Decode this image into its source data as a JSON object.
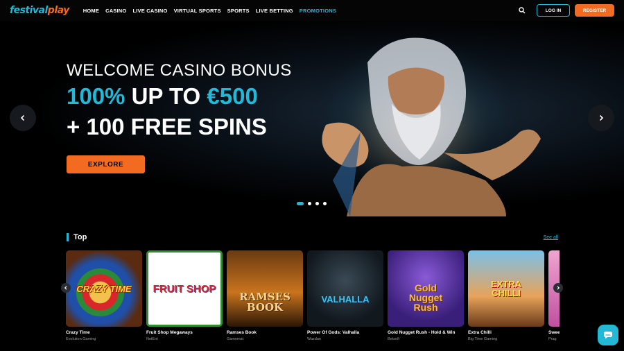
{
  "brand": {
    "logo_part1": "festival",
    "logo_part2": "play",
    "accent": "#22b8d6",
    "orange": "#f26b21"
  },
  "nav": [
    {
      "label": "HOME",
      "active": false
    },
    {
      "label": "CASINO",
      "active": false
    },
    {
      "label": "LIVE CASINO",
      "active": false
    },
    {
      "label": "VIRTUAL SPORTS",
      "active": false
    },
    {
      "label": "SPORTS",
      "active": false
    },
    {
      "label": "LIVE BETTING",
      "active": false
    },
    {
      "label": "PROMOTIONS",
      "active": true
    }
  ],
  "header": {
    "search_icon": "search-icon",
    "login_label": "LOG IN",
    "register_label": "REGISTER"
  },
  "hero": {
    "line1": "WELCOME CASINO BONUS",
    "line2_highlight1": "100%",
    "line2_middle": " UP TO ",
    "line2_highlight2": "€500",
    "line3": "+ 100 FREE SPINS",
    "cta_label": "EXPLORE",
    "slides_total": 4,
    "active_slide": 1
  },
  "top_section": {
    "title": "Top",
    "see_all": "See all",
    "games": [
      {
        "name": "Crazy Time",
        "provider": "Evolution Gaming",
        "art": "CRAZY TIME"
      },
      {
        "name": "Fruit Shop Megaways",
        "provider": "NetEnt",
        "art": "FRUIT SHOP"
      },
      {
        "name": "Ramses Book",
        "provider": "Gamomat",
        "art": "RAMSES BOOK"
      },
      {
        "name": "Power Of Gods: Valhalla",
        "provider": "Wazdan",
        "art": "VALHALLA"
      },
      {
        "name": "Gold Nugget Rush - Hold & Win",
        "provider": "Betsoft",
        "art": "Gold Nugget Rush"
      },
      {
        "name": "Extra Chilli",
        "provider": "Big Time Gaming",
        "art": "EXTRA CHILLI"
      }
    ],
    "partial_game": {
      "name": "Swee",
      "provider": "Prag"
    }
  }
}
